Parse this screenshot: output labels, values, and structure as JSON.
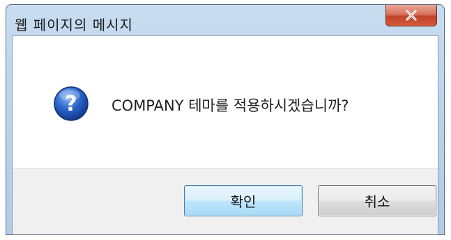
{
  "window": {
    "title": "웹 페이지의 메시지"
  },
  "dialog": {
    "icon": "question-icon",
    "message": "COMPANY 테마를 적용하시겠습니까?"
  },
  "buttons": {
    "ok_label": "확인",
    "cancel_label": "취소"
  },
  "colors": {
    "close_button": "#c2422a",
    "ok_button_border": "#3c7fb1",
    "title_bar": "#bcd3ec"
  }
}
